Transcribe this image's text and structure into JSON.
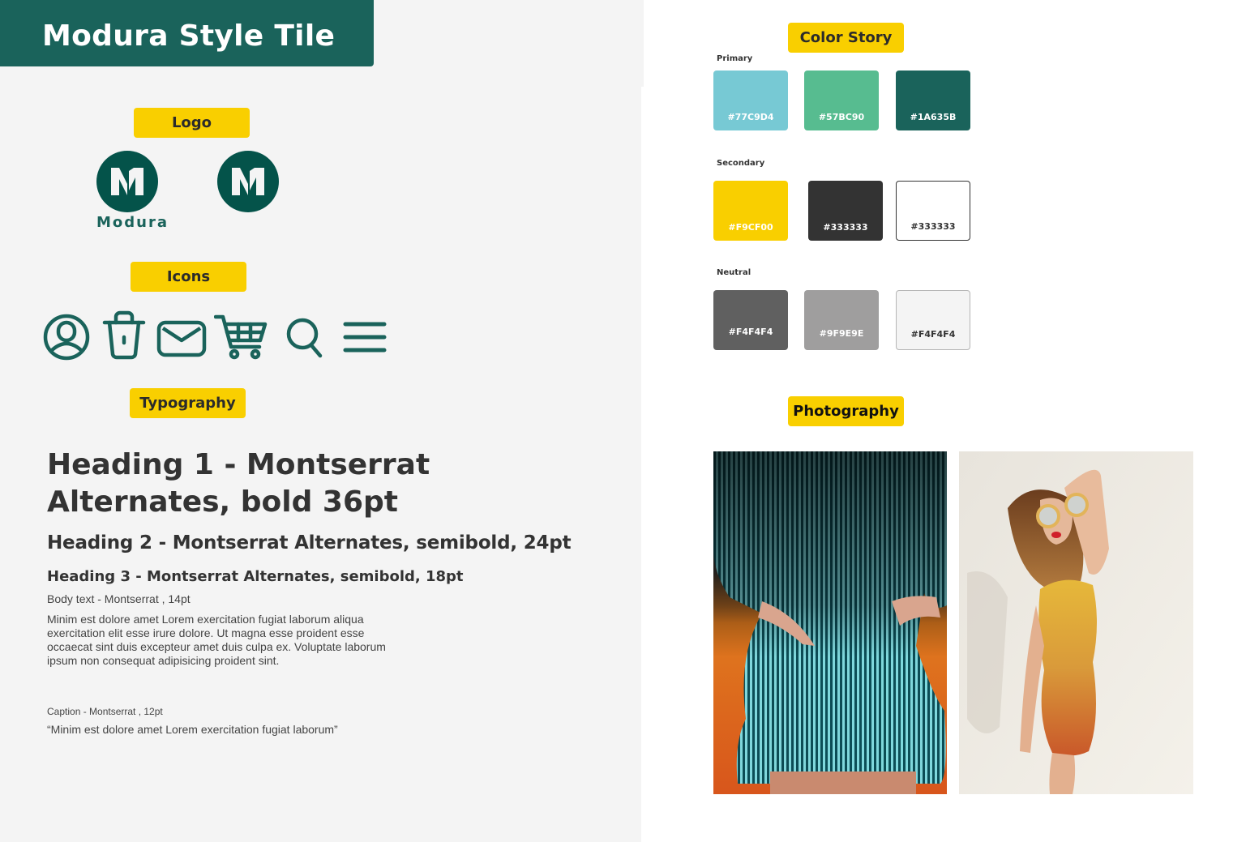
{
  "title": "Modura Style Tile",
  "sections": {
    "logo": "Logo",
    "icons": "Icons",
    "typography": "Typography",
    "color_story": "Color Story",
    "photography": "Photography"
  },
  "logo": {
    "letter": "M",
    "wordmark": "Modura"
  },
  "icons": [
    "user-circle-icon",
    "trash-icon",
    "mail-icon",
    "cart-icon",
    "search-icon",
    "menu-icon"
  ],
  "typography": {
    "h1": "Heading 1 - Montserrat Alternates, bold 36pt",
    "h2": "Heading 2 - Montserrat Alternates, semibold, 24pt",
    "h3": "Heading 3 - Montserrat Alternates, semibold, 18pt",
    "body_label": "Body text  - Montserrat , 14pt",
    "body_text": "Minim est dolore amet Lorem exercitation fugiat laborum aliqua exercitation elit esse irure dolore. Ut magna esse proident esse occaecat sint duis excepteur amet duis culpa ex. Voluptate laborum ipsum non consequat adipisicing proident sint.",
    "caption_label": "Caption  - Montserrat , 12pt",
    "caption_text": "“Minim est dolore amet Lorem exercitation fugiat laborum”"
  },
  "colors": {
    "primary": {
      "label": "Primary",
      "swatches": [
        {
          "hex_label": "#77C9D4",
          "fill": "#77C9D4",
          "text": "#ffffff"
        },
        {
          "hex_label": "#57BC90",
          "fill": "#57BC90",
          "text": "#ffffff"
        },
        {
          "hex_label": "#1A635B",
          "fill": "#1A635B",
          "text": "#ffffff"
        }
      ]
    },
    "secondary": {
      "label": "Secondary",
      "swatches": [
        {
          "hex_label": "#F9CF00",
          "fill": "#F9CF00",
          "text": "#ffffff"
        },
        {
          "hex_label": "#333333",
          "fill": "#333333",
          "text": "#ffffff"
        },
        {
          "hex_label": "#333333",
          "fill": "#ffffff",
          "text": "#333333",
          "border": "#333333"
        }
      ]
    },
    "neutral": {
      "label": "Neutral",
      "swatches": [
        {
          "hex_label": "#F4F4F4",
          "fill": "#606060",
          "text": "#ffffff"
        },
        {
          "hex_label": "#9F9E9E",
          "fill": "#9F9E9E",
          "text": "#ffffff"
        },
        {
          "hex_label": "#F4F4F4",
          "fill": "#F4F4F4",
          "text": "#333333",
          "border": "#b5b5b5"
        }
      ]
    }
  },
  "photos": [
    {
      "name": "striped-shirt-dress-photo"
    },
    {
      "name": "gold-sequin-dress-photo"
    }
  ]
}
